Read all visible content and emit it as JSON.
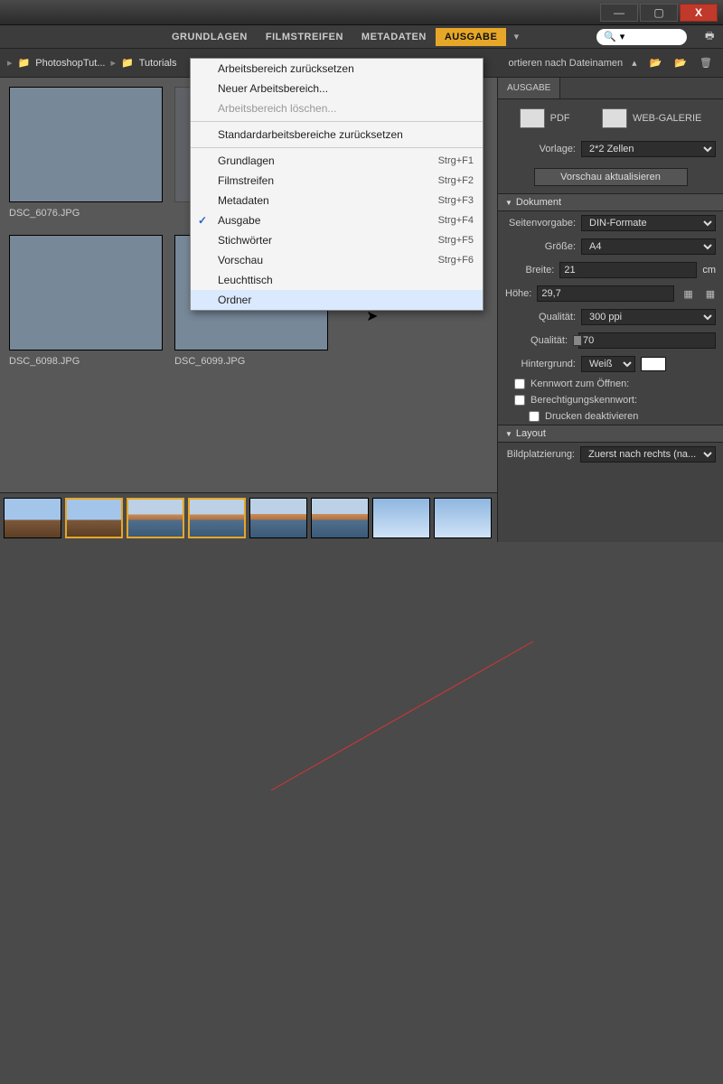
{
  "window": {
    "min": "—",
    "max": "▢",
    "close": "X"
  },
  "topmenu": {
    "tabs": [
      "GRUNDLAGEN",
      "FILMSTREIFEN",
      "METADATEN",
      "AUSGABE"
    ],
    "active": 3,
    "search_placeholder": ""
  },
  "pathbar": {
    "segments": [
      "PhotoshopTut...",
      "Tutorials"
    ],
    "sort_label": "ortieren nach Dateinamen"
  },
  "dropdown": {
    "items": [
      {
        "label": "Arbeitsbereich zurücksetzen"
      },
      {
        "label": "Neuer Arbeitsbereich..."
      },
      {
        "label": "Arbeitsbereich löschen...",
        "disabled": true
      },
      {
        "sep": true
      },
      {
        "label": "Standardarbeitsbereiche zurücksetzen"
      },
      {
        "sep": true
      },
      {
        "label": "Grundlagen",
        "shortcut": "Strg+F1"
      },
      {
        "label": "Filmstreifen",
        "shortcut": "Strg+F2"
      },
      {
        "label": "Metadaten",
        "shortcut": "Strg+F3"
      },
      {
        "label": "Ausgabe",
        "shortcut": "Strg+F4",
        "checked": true
      },
      {
        "label": "Stichwörter",
        "shortcut": "Strg+F5"
      },
      {
        "label": "Vorschau",
        "shortcut": "Strg+F6"
      },
      {
        "label": "Leuchttisch"
      },
      {
        "label": "Ordner",
        "hover": true
      }
    ]
  },
  "thumbs": [
    {
      "caption": "DSC_6076.JPG",
      "style": "fill-tower"
    },
    {
      "caption": "",
      "style": "sky"
    },
    {
      "caption": "DSC_6098.JPG",
      "style": "fill-harbor"
    },
    {
      "caption": "DSC_6099.JPG",
      "style": "fill-harbor"
    }
  ],
  "rpanel": {
    "tab": "AUSGABE",
    "pdf_btn": "PDF",
    "web_btn": "WEB-GALERIE",
    "vorlage_label": "Vorlage:",
    "vorlage_value": "2*2 Zellen",
    "refresh_btn": "Vorschau aktualisieren",
    "sections": {
      "dokument": "Dokument",
      "layout": "Layout"
    },
    "fields": {
      "seitenvorgabe_label": "Seitenvorgabe:",
      "seitenvorgabe_value": "DIN-Formate",
      "groesse_label": "Größe:",
      "groesse_value": "A4",
      "breite_label": "Breite:",
      "breite_value": "21",
      "breite_unit": "cm",
      "hoehe_label": "Höhe:",
      "hoehe_value": "29,7",
      "qualitaet_label": "Qualität:",
      "qualitaet_value": "300 ppi",
      "qualitaet2_label": "Qualität:",
      "qualitaet2_value": "70",
      "hintergrund_label": "Hintergrund:",
      "hintergrund_value": "Weiß"
    },
    "checks": {
      "kennwort": "Kennwort zum Öffnen:",
      "berecht": "Berechtigungskennwort:",
      "drucken": "Drucken deaktivieren"
    },
    "bildplatz_label": "Bildplatzierung:",
    "bildplatz_value": "Zuerst nach rechts (na..."
  }
}
